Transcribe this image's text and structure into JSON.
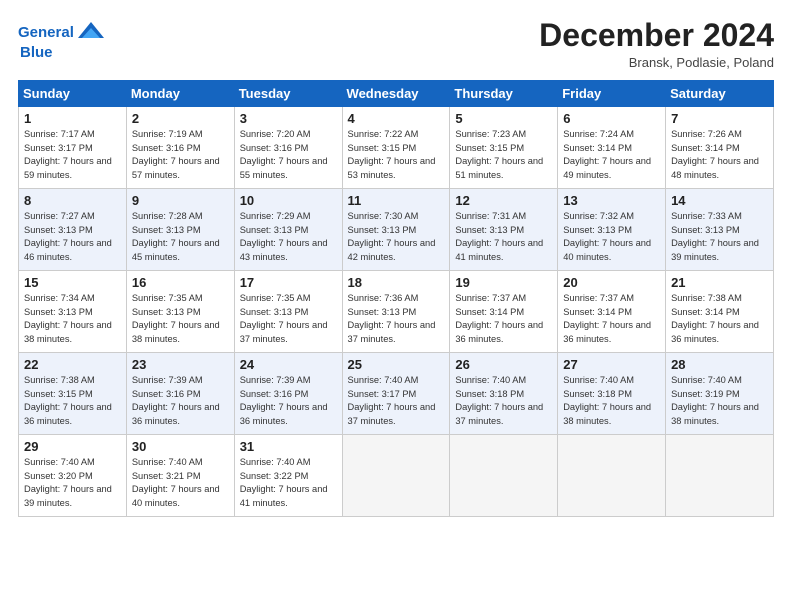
{
  "header": {
    "logo_line1": "General",
    "logo_line2": "Blue",
    "month": "December 2024",
    "location": "Bransk, Podlasie, Poland"
  },
  "days_of_week": [
    "Sunday",
    "Monday",
    "Tuesday",
    "Wednesday",
    "Thursday",
    "Friday",
    "Saturday"
  ],
  "weeks": [
    [
      {
        "num": "1",
        "sunrise": "7:17 AM",
        "sunset": "3:17 PM",
        "daylight": "7 hours and 59 minutes."
      },
      {
        "num": "2",
        "sunrise": "7:19 AM",
        "sunset": "3:16 PM",
        "daylight": "7 hours and 57 minutes."
      },
      {
        "num": "3",
        "sunrise": "7:20 AM",
        "sunset": "3:16 PM",
        "daylight": "7 hours and 55 minutes."
      },
      {
        "num": "4",
        "sunrise": "7:22 AM",
        "sunset": "3:15 PM",
        "daylight": "7 hours and 53 minutes."
      },
      {
        "num": "5",
        "sunrise": "7:23 AM",
        "sunset": "3:15 PM",
        "daylight": "7 hours and 51 minutes."
      },
      {
        "num": "6",
        "sunrise": "7:24 AM",
        "sunset": "3:14 PM",
        "daylight": "7 hours and 49 minutes."
      },
      {
        "num": "7",
        "sunrise": "7:26 AM",
        "sunset": "3:14 PM",
        "daylight": "7 hours and 48 minutes."
      }
    ],
    [
      {
        "num": "8",
        "sunrise": "7:27 AM",
        "sunset": "3:13 PM",
        "daylight": "7 hours and 46 minutes."
      },
      {
        "num": "9",
        "sunrise": "7:28 AM",
        "sunset": "3:13 PM",
        "daylight": "7 hours and 45 minutes."
      },
      {
        "num": "10",
        "sunrise": "7:29 AM",
        "sunset": "3:13 PM",
        "daylight": "7 hours and 43 minutes."
      },
      {
        "num": "11",
        "sunrise": "7:30 AM",
        "sunset": "3:13 PM",
        "daylight": "7 hours and 42 minutes."
      },
      {
        "num": "12",
        "sunrise": "7:31 AM",
        "sunset": "3:13 PM",
        "daylight": "7 hours and 41 minutes."
      },
      {
        "num": "13",
        "sunrise": "7:32 AM",
        "sunset": "3:13 PM",
        "daylight": "7 hours and 40 minutes."
      },
      {
        "num": "14",
        "sunrise": "7:33 AM",
        "sunset": "3:13 PM",
        "daylight": "7 hours and 39 minutes."
      }
    ],
    [
      {
        "num": "15",
        "sunrise": "7:34 AM",
        "sunset": "3:13 PM",
        "daylight": "7 hours and 38 minutes."
      },
      {
        "num": "16",
        "sunrise": "7:35 AM",
        "sunset": "3:13 PM",
        "daylight": "7 hours and 38 minutes."
      },
      {
        "num": "17",
        "sunrise": "7:35 AM",
        "sunset": "3:13 PM",
        "daylight": "7 hours and 37 minutes."
      },
      {
        "num": "18",
        "sunrise": "7:36 AM",
        "sunset": "3:13 PM",
        "daylight": "7 hours and 37 minutes."
      },
      {
        "num": "19",
        "sunrise": "7:37 AM",
        "sunset": "3:14 PM",
        "daylight": "7 hours and 36 minutes."
      },
      {
        "num": "20",
        "sunrise": "7:37 AM",
        "sunset": "3:14 PM",
        "daylight": "7 hours and 36 minutes."
      },
      {
        "num": "21",
        "sunrise": "7:38 AM",
        "sunset": "3:14 PM",
        "daylight": "7 hours and 36 minutes."
      }
    ],
    [
      {
        "num": "22",
        "sunrise": "7:38 AM",
        "sunset": "3:15 PM",
        "daylight": "7 hours and 36 minutes."
      },
      {
        "num": "23",
        "sunrise": "7:39 AM",
        "sunset": "3:16 PM",
        "daylight": "7 hours and 36 minutes."
      },
      {
        "num": "24",
        "sunrise": "7:39 AM",
        "sunset": "3:16 PM",
        "daylight": "7 hours and 36 minutes."
      },
      {
        "num": "25",
        "sunrise": "7:40 AM",
        "sunset": "3:17 PM",
        "daylight": "7 hours and 37 minutes."
      },
      {
        "num": "26",
        "sunrise": "7:40 AM",
        "sunset": "3:18 PM",
        "daylight": "7 hours and 37 minutes."
      },
      {
        "num": "27",
        "sunrise": "7:40 AM",
        "sunset": "3:18 PM",
        "daylight": "7 hours and 38 minutes."
      },
      {
        "num": "28",
        "sunrise": "7:40 AM",
        "sunset": "3:19 PM",
        "daylight": "7 hours and 38 minutes."
      }
    ],
    [
      {
        "num": "29",
        "sunrise": "7:40 AM",
        "sunset": "3:20 PM",
        "daylight": "7 hours and 39 minutes."
      },
      {
        "num": "30",
        "sunrise": "7:40 AM",
        "sunset": "3:21 PM",
        "daylight": "7 hours and 40 minutes."
      },
      {
        "num": "31",
        "sunrise": "7:40 AM",
        "sunset": "3:22 PM",
        "daylight": "7 hours and 41 minutes."
      },
      null,
      null,
      null,
      null
    ]
  ]
}
